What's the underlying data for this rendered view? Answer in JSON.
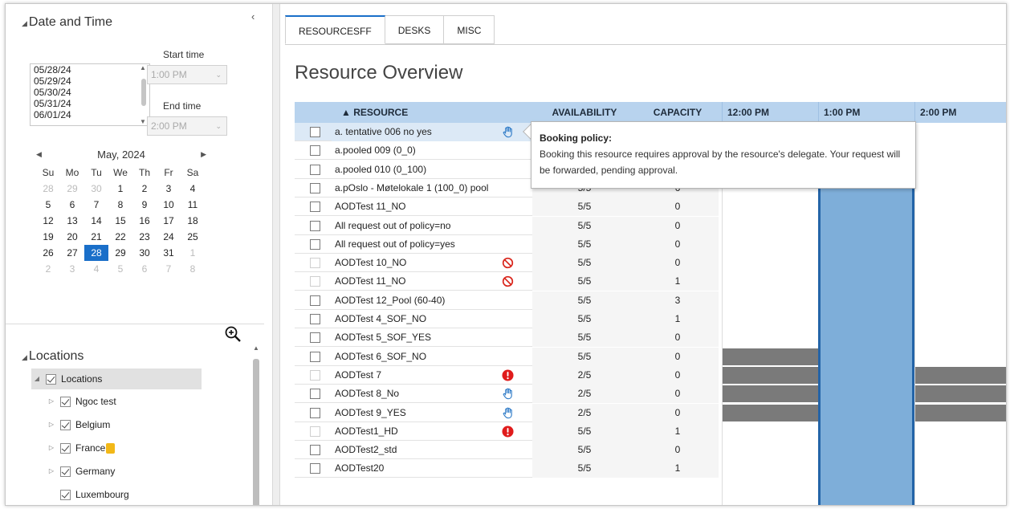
{
  "datetime": {
    "title": "Date and Time",
    "dates": [
      "05/28/24",
      "05/29/24",
      "05/30/24",
      "05/31/24",
      "06/01/24"
    ],
    "start_label": "Start time",
    "start_value": "1:00 PM",
    "end_label": "End time",
    "end_value": "2:00 PM"
  },
  "calendar": {
    "month_label": "May, 2024",
    "weekdays": [
      "Su",
      "Mo",
      "Tu",
      "We",
      "Th",
      "Fr",
      "Sa"
    ],
    "days": [
      {
        "d": "28",
        "dim": true
      },
      {
        "d": "29",
        "dim": true
      },
      {
        "d": "30",
        "dim": true
      },
      {
        "d": "1"
      },
      {
        "d": "2"
      },
      {
        "d": "3"
      },
      {
        "d": "4"
      },
      {
        "d": "5"
      },
      {
        "d": "6"
      },
      {
        "d": "7"
      },
      {
        "d": "8"
      },
      {
        "d": "9"
      },
      {
        "d": "10"
      },
      {
        "d": "11"
      },
      {
        "d": "12"
      },
      {
        "d": "13"
      },
      {
        "d": "14"
      },
      {
        "d": "15"
      },
      {
        "d": "16"
      },
      {
        "d": "17"
      },
      {
        "d": "18"
      },
      {
        "d": "19"
      },
      {
        "d": "20"
      },
      {
        "d": "21"
      },
      {
        "d": "22"
      },
      {
        "d": "23"
      },
      {
        "d": "24"
      },
      {
        "d": "25"
      },
      {
        "d": "26"
      },
      {
        "d": "27"
      },
      {
        "d": "28",
        "sel": true
      },
      {
        "d": "29"
      },
      {
        "d": "30"
      },
      {
        "d": "31"
      },
      {
        "d": "1",
        "dim": true
      },
      {
        "d": "2",
        "dim": true
      },
      {
        "d": "3",
        "dim": true
      },
      {
        "d": "4",
        "dim": true
      },
      {
        "d": "5",
        "dim": true
      },
      {
        "d": "6",
        "dim": true
      },
      {
        "d": "7",
        "dim": true
      },
      {
        "d": "8",
        "dim": true
      }
    ]
  },
  "locations": {
    "title": "Locations",
    "root": "Locations",
    "items": [
      {
        "label": "Ngoc test",
        "expandable": true
      },
      {
        "label": "Belgium",
        "expandable": true
      },
      {
        "label": "France",
        "expandable": true,
        "badge": "info-icon"
      },
      {
        "label": "Germany",
        "expandable": true
      },
      {
        "label": "Luxembourg",
        "expandable": false
      }
    ]
  },
  "tabs": [
    "RESOURCESFF",
    "DESKS",
    "MISC"
  ],
  "page_title": "Resource Overview",
  "grid": {
    "columns": {
      "resource": "▲ RESOURCE",
      "availability": "AVAILABILITY",
      "capacity": "CAPACITY"
    },
    "time_slots": [
      "12:00 PM",
      "1:00 PM",
      "2:00 PM"
    ],
    "rows": [
      {
        "name": "a. tentative 006 no yes",
        "availability": "",
        "capacity": "",
        "icon": "hand-icon",
        "highlight": true
      },
      {
        "name": "a.pooled 009 (0_0)",
        "availability": "",
        "capacity": ""
      },
      {
        "name": "a.pooled 010 (0_100)",
        "availability": "",
        "capacity": ""
      },
      {
        "name": "a.pOslo - Møtelokale 1 (100_0) pool",
        "availability": "5/5",
        "capacity": "6"
      },
      {
        "name": "AODTest 11_NO",
        "availability": "5/5",
        "capacity": "0"
      },
      {
        "name": "All request out of policy=no",
        "availability": "5/5",
        "capacity": "0"
      },
      {
        "name": "All request out of policy=yes",
        "availability": "5/5",
        "capacity": "0"
      },
      {
        "name": "AODTest 10_NO",
        "availability": "5/5",
        "capacity": "0",
        "icon": "prohibited-icon",
        "disabled": true
      },
      {
        "name": "AODTest 11_NO",
        "availability": "5/5",
        "capacity": "1",
        "icon": "prohibited-icon",
        "disabled": true
      },
      {
        "name": "AODTest 12_Pool (60-40)",
        "availability": "5/5",
        "capacity": "3"
      },
      {
        "name": "AODTest 4_SOF_NO",
        "availability": "5/5",
        "capacity": "1"
      },
      {
        "name": "AODTest 5_SOF_YES",
        "availability": "5/5",
        "capacity": "0"
      },
      {
        "name": "AODTest 6_SOF_NO",
        "availability": "5/5",
        "capacity": "0",
        "busy": "left"
      },
      {
        "name": "AODTest 7",
        "availability": "2/5",
        "capacity": "0",
        "icon": "alert-icon",
        "disabled": true,
        "busy": "full"
      },
      {
        "name": "AODTest 8_No",
        "availability": "2/5",
        "capacity": "0",
        "icon": "hand-icon",
        "busy": "full"
      },
      {
        "name": "AODTest 9_YES",
        "availability": "2/5",
        "capacity": "0",
        "icon": "hand-icon",
        "busy": "full"
      },
      {
        "name": "AODTest1_HD",
        "availability": "5/5",
        "capacity": "1",
        "icon": "alert-icon",
        "disabled": true
      },
      {
        "name": "AODTest2_std",
        "availability": "5/5",
        "capacity": "0"
      },
      {
        "name": "AODTest20",
        "availability": "5/5",
        "capacity": "1"
      }
    ]
  },
  "tooltip": {
    "title": "Booking policy:",
    "body": "Booking this resource requires approval by the resource's delegate. Your request will be forwarded, pending approval."
  },
  "colors": {
    "accent": "#1a6fc9",
    "header_bg": "#b8d3ee",
    "current_slot": "#7eaed9",
    "busy": "#7a7a7a",
    "alert": "#e01b1b",
    "prohibited": "#d9261c"
  }
}
